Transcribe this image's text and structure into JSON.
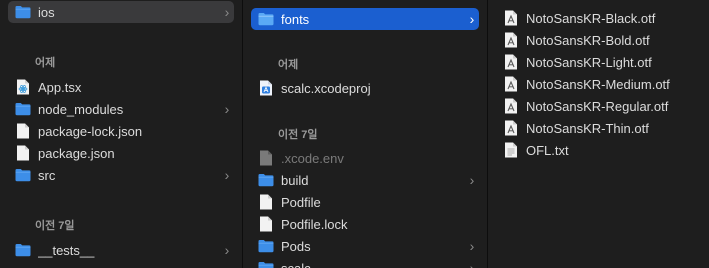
{
  "columns": [
    {
      "items": [
        {
          "label": "ios",
          "icon": "folder-icon",
          "chevron": true,
          "state": "selected-inactive"
        },
        {
          "label": "App.tsx",
          "icon": "tsx-file-icon",
          "chevron": false
        },
        {
          "label": "node_modules",
          "icon": "folder-icon",
          "chevron": true
        },
        {
          "label": "package-lock.json",
          "icon": "document-icon",
          "chevron": false
        },
        {
          "label": "package.json",
          "icon": "document-icon",
          "chevron": false
        },
        {
          "label": "src",
          "icon": "folder-icon",
          "chevron": true
        },
        {
          "label": "__tests__",
          "icon": "folder-icon",
          "chevron": true
        }
      ],
      "sections": [
        "어제",
        "이전 7일"
      ]
    },
    {
      "items": [
        {
          "label": "fonts",
          "icon": "folder-icon",
          "chevron": true,
          "state": "selected-active"
        },
        {
          "label": "scalc.xcodeproj",
          "icon": "xcodeproj-icon",
          "chevron": false
        },
        {
          "label": ".xcode.env",
          "icon": "document-icon",
          "chevron": false,
          "dim": true
        },
        {
          "label": "build",
          "icon": "folder-icon",
          "chevron": true
        },
        {
          "label": "Podfile",
          "icon": "document-icon",
          "chevron": false
        },
        {
          "label": "Podfile.lock",
          "icon": "document-icon",
          "chevron": false
        },
        {
          "label": "Pods",
          "icon": "folder-icon",
          "chevron": true
        },
        {
          "label": "scalc",
          "icon": "folder-icon",
          "chevron": true
        }
      ],
      "sections": [
        "어제",
        "이전 7일"
      ]
    },
    {
      "items": [
        {
          "label": "NotoSansKR-Black.otf",
          "icon": "font-file-icon"
        },
        {
          "label": "NotoSansKR-Bold.otf",
          "icon": "font-file-icon"
        },
        {
          "label": "NotoSansKR-Light.otf",
          "icon": "font-file-icon"
        },
        {
          "label": "NotoSansKR-Medium.otf",
          "icon": "font-file-icon"
        },
        {
          "label": "NotoSansKR-Regular.otf",
          "icon": "font-file-icon"
        },
        {
          "label": "NotoSansKR-Thin.otf",
          "icon": "font-file-icon"
        },
        {
          "label": "OFL.txt",
          "icon": "document-icon"
        }
      ]
    }
  ],
  "colors": {
    "background": "#1e1e1e",
    "selection_active": "#1b5fd0",
    "selection_inactive": "#3a3a3c",
    "folder": "#3d8ee8",
    "text": "#dcdcdc",
    "section_header": "#9a9a9a"
  }
}
